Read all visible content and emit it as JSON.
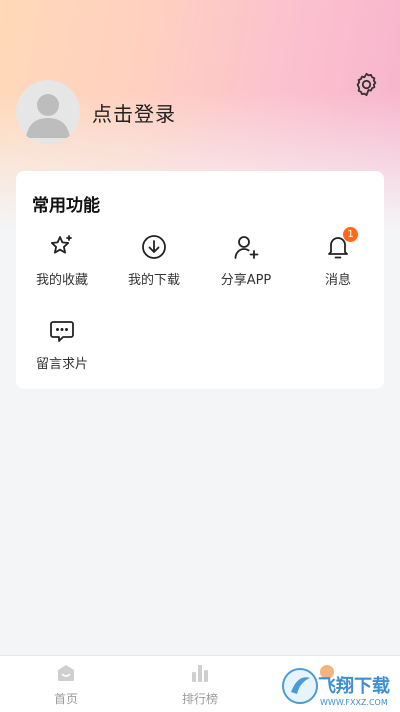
{
  "header": {
    "login_text": "点击登录",
    "settings_icon": "gear-icon",
    "avatar_icon": "user-avatar-icon"
  },
  "features": {
    "title": "常用功能",
    "items": [
      {
        "label": "我的收藏",
        "icon": "star-icon"
      },
      {
        "label": "我的下载",
        "icon": "download-icon"
      },
      {
        "label": "分享APP",
        "icon": "add-user-icon"
      },
      {
        "label": "消息",
        "icon": "bell-icon",
        "badge": "1"
      },
      {
        "label": "留言求片",
        "icon": "message-icon"
      }
    ]
  },
  "tabbar": {
    "items": [
      {
        "label": "首页",
        "icon": "home-icon"
      },
      {
        "label": "排行榜",
        "icon": "chart-icon"
      }
    ]
  },
  "watermark": {
    "text": "飞翔下载",
    "url": "WWW.FXXZ.COM"
  },
  "colors": {
    "accent": "#ff6a1a",
    "background": "#f4f5f7",
    "card": "#ffffff",
    "tab_inactive": "#9b9b9b"
  }
}
